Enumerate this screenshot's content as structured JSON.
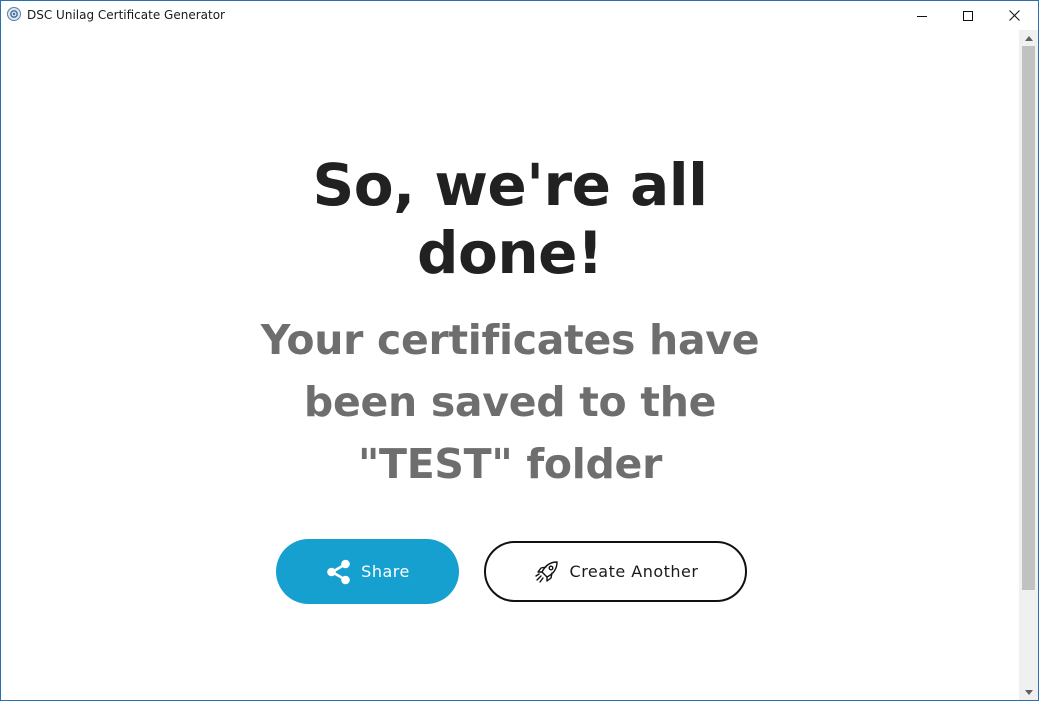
{
  "window": {
    "title": "DSC Unilag Certificate Generator",
    "icons": {
      "app": "app-logo-icon",
      "minimize": "minimize-icon",
      "maximize": "maximize-icon",
      "close": "close-icon"
    }
  },
  "main": {
    "headline_line1": "So, we're all",
    "headline_line2": "done!",
    "subhead_line1": "Your certificates have",
    "subhead_line2": "been saved to the",
    "subhead_line3": "\"TEST\" folder"
  },
  "actions": {
    "share_label": "Share",
    "share_icon": "share-icon",
    "create_label": "Create Another",
    "create_icon": "rocket-icon"
  },
  "colors": {
    "accent": "#16a0cf",
    "headline": "#212121",
    "subhead": "#6e6e6e"
  }
}
